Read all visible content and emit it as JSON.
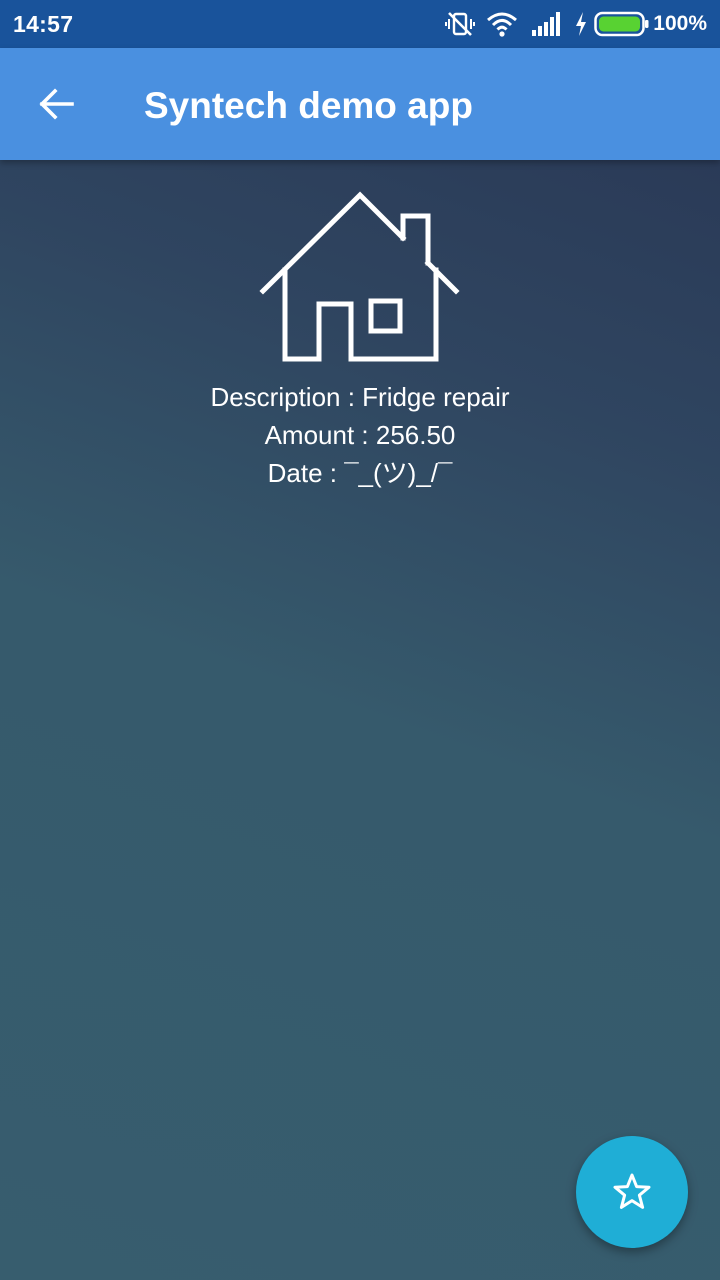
{
  "status_bar": {
    "time": "14:57",
    "battery_percent": "100%",
    "icons": [
      "vibrate-off-icon",
      "wifi-icon",
      "signal-icon",
      "charging-icon",
      "battery-icon"
    ]
  },
  "app_bar": {
    "back_icon": "arrow-left-icon",
    "title": "Syntech demo app",
    "color": "#4a90e0"
  },
  "content": {
    "icon": "house-icon",
    "description": "Description : Fridge repair",
    "amount": "Amount : 256.50",
    "date": "Date : ¯_(ツ)_/¯"
  },
  "fab": {
    "icon": "star-icon",
    "color": "#1faed6"
  }
}
